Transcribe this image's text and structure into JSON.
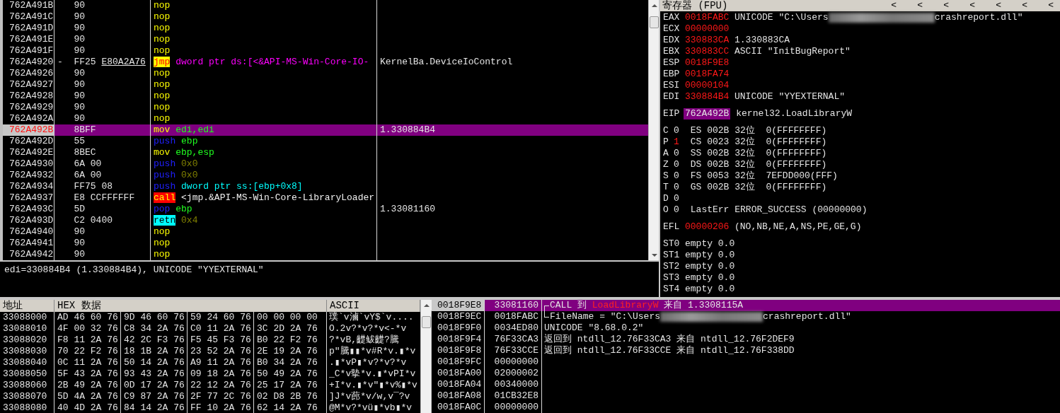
{
  "disassembly": {
    "rows": [
      {
        "address": "762A491B",
        "hex": "90",
        "tokens": [
          {
            "kind": "op",
            "text": "nop"
          }
        ],
        "selected": false
      },
      {
        "address": "762A491C",
        "hex": "90",
        "tokens": [
          {
            "kind": "op",
            "text": "nop"
          }
        ],
        "selected": false
      },
      {
        "address": "762A491D",
        "hex": "90",
        "tokens": [
          {
            "kind": "op",
            "text": "nop"
          }
        ],
        "selected": false
      },
      {
        "address": "762A491E",
        "hex": "90",
        "tokens": [
          {
            "kind": "op",
            "text": "nop"
          }
        ],
        "selected": false
      },
      {
        "address": "762A491F",
        "hex": "90",
        "tokens": [
          {
            "kind": "op",
            "text": "nop"
          }
        ],
        "selected": false
      },
      {
        "address": "762A4920",
        "marker": "-",
        "hex": "FF25",
        "hex_ref": "E80A2A76",
        "tokens": [
          {
            "kind": "jump",
            "text": "jmp"
          },
          {
            "kind": "import",
            "text": "dword ptr ds:[<&API-MS-Win-Core-IO-"
          }
        ],
        "comment": "KernelBa.DeviceIoControl",
        "selected": false
      },
      {
        "address": "762A4926",
        "hex": "90",
        "tokens": [
          {
            "kind": "op",
            "text": "nop"
          }
        ],
        "selected": false
      },
      {
        "address": "762A4927",
        "hex": "90",
        "tokens": [
          {
            "kind": "op",
            "text": "nop"
          }
        ],
        "selected": false
      },
      {
        "address": "762A4928",
        "hex": "90",
        "tokens": [
          {
            "kind": "op",
            "text": "nop"
          }
        ],
        "selected": false
      },
      {
        "address": "762A4929",
        "hex": "90",
        "tokens": [
          {
            "kind": "op",
            "text": "nop"
          }
        ],
        "selected": false
      },
      {
        "address": "762A492A",
        "hex": "90",
        "tokens": [
          {
            "kind": "op",
            "text": "nop"
          }
        ],
        "selected": false
      },
      {
        "address": "762A492B",
        "hex": "8BFF",
        "tokens": [
          {
            "kind": "op",
            "text": "mov"
          },
          {
            "kind": "reg",
            "text": "edi,edi"
          }
        ],
        "comment": "1.330884B4",
        "selected": true
      },
      {
        "address": "762A492D",
        "hex": "55",
        "tokens": [
          {
            "kind": "stack",
            "text": "push"
          },
          {
            "kind": "reg",
            "text": "ebp"
          }
        ],
        "selected": false
      },
      {
        "address": "762A492E",
        "hex": "8BEC",
        "tokens": [
          {
            "kind": "op",
            "text": "mov"
          },
          {
            "kind": "reg",
            "text": "ebp,esp"
          }
        ],
        "selected": false
      },
      {
        "address": "762A4930",
        "hex": "6A 00",
        "tokens": [
          {
            "kind": "stack",
            "text": "push"
          },
          {
            "kind": "imm",
            "text": "0x0"
          }
        ],
        "selected": false
      },
      {
        "address": "762A4932",
        "hex": "6A 00",
        "tokens": [
          {
            "kind": "stack",
            "text": "push"
          },
          {
            "kind": "imm",
            "text": "0x0"
          }
        ],
        "selected": false
      },
      {
        "address": "762A4934",
        "hex": "FF75 08",
        "tokens": [
          {
            "kind": "stack",
            "text": "push"
          },
          {
            "kind": "mem",
            "text": "dword ptr ss:[ebp+0x8]"
          }
        ],
        "selected": false
      },
      {
        "address": "762A4937",
        "hex": "E8 CCFFFFFF",
        "tokens": [
          {
            "kind": "call",
            "text": "call"
          },
          {
            "kind": "plain",
            "text": "<jmp.&API-MS-Win-Core-LibraryLoader"
          }
        ],
        "selected": false
      },
      {
        "address": "762A493C",
        "hex": "5D",
        "tokens": [
          {
            "kind": "stack",
            "text": "pop"
          },
          {
            "kind": "reg",
            "text": "ebp"
          }
        ],
        "comment": "1.33081160",
        "selected": false
      },
      {
        "address": "762A493D",
        "hex": "C2 0400",
        "tokens": [
          {
            "kind": "ret",
            "text": "retn"
          },
          {
            "kind": "imm",
            "text": "0x4"
          }
        ],
        "selected": false
      },
      {
        "address": "762A4940",
        "hex": "90",
        "tokens": [
          {
            "kind": "op",
            "text": "nop"
          }
        ],
        "selected": false
      },
      {
        "address": "762A4941",
        "hex": "90",
        "tokens": [
          {
            "kind": "op",
            "text": "nop"
          }
        ],
        "selected": false
      },
      {
        "address": "762A4942",
        "hex": "90",
        "tokens": [
          {
            "kind": "op",
            "text": "nop"
          }
        ],
        "selected": false
      }
    ]
  },
  "info_line": "edi=330884B4 (1.330884B4), UNICODE \"YYEXTERNAL\"",
  "registers": {
    "title": "寄存器 (FPU)",
    "arrows": [
      "<",
      "<",
      "<",
      "<",
      "<",
      "<",
      "<"
    ],
    "general": [
      {
        "name": "EAX",
        "value": "0018FABC",
        "changed": true,
        "comment": [
          {
            "kind": "text",
            "text": "UNICODE \"C:\\Users"
          },
          {
            "kind": "redacted"
          },
          {
            "kind": "text",
            "text": "crashreport.dll\""
          }
        ]
      },
      {
        "name": "ECX",
        "value": "00000000",
        "changed": true
      },
      {
        "name": "EDX",
        "value": "330883CA",
        "changed": true,
        "comment": [
          {
            "kind": "text",
            "text": "1.330883CA"
          }
        ]
      },
      {
        "name": "EBX",
        "value": "330883CC",
        "changed": true,
        "comment": [
          {
            "kind": "text",
            "text": "ASCII \"InitBugReport\""
          }
        ]
      },
      {
        "name": "ESP",
        "value": "0018F9E8",
        "changed": true
      },
      {
        "name": "EBP",
        "value": "0018FA74",
        "changed": true
      },
      {
        "name": "ESI",
        "value": "00000104",
        "changed": true
      },
      {
        "name": "EDI",
        "value": "330884B4",
        "changed": true,
        "comment": [
          {
            "kind": "text",
            "text": "UNICODE \"YYEXTERNAL\""
          }
        ]
      }
    ],
    "eip": {
      "name": "EIP",
      "value": "762A492B",
      "highlighted": true,
      "comment": "kernel32.LoadLibraryW"
    },
    "flags": [
      {
        "name": "C",
        "value": "0",
        "changed": false,
        "segment": "ES 002B 32位  0(FFFFFFFF)"
      },
      {
        "name": "P",
        "value": "1",
        "changed": true,
        "segment": "CS 0023 32位  0(FFFFFFFF)"
      },
      {
        "name": "A",
        "value": "0",
        "changed": false,
        "segment": "SS 002B 32位  0(FFFFFFFF)"
      },
      {
        "name": "Z",
        "value": "0",
        "changed": false,
        "segment": "DS 002B 32位  0(FFFFFFFF)"
      },
      {
        "name": "S",
        "value": "0",
        "changed": false,
        "segment": "FS 0053 32位  7EFDD000(FFF)"
      },
      {
        "name": "T",
        "value": "0",
        "changed": false,
        "segment": "GS 002B 32位  0(FFFFFFFF)"
      },
      {
        "name": "D",
        "value": "0",
        "changed": false
      },
      {
        "name": "O",
        "value": "0",
        "changed": false,
        "segment": "LastErr ERROR_SUCCESS (00000000)"
      }
    ],
    "efl": {
      "name": "EFL",
      "value": "00000206",
      "changed": true,
      "comment": "(NO,NB,NE,A,NS,PE,GE,G)"
    },
    "fpu": [
      {
        "name": "ST0",
        "text": "empty 0.0"
      },
      {
        "name": "ST1",
        "text": "empty 0.0"
      },
      {
        "name": "ST2",
        "text": "empty 0.0"
      },
      {
        "name": "ST3",
        "text": "empty 0.0"
      },
      {
        "name": "ST4",
        "text": "empty 0.0"
      }
    ]
  },
  "dump": {
    "columns": [
      "地址",
      "HEX 数据",
      "ASCII"
    ],
    "rows": [
      {
        "address": "33088000",
        "groups": [
          "AD 46 60 76",
          "9D 46 60 76",
          "59 24 60 76",
          "00 00 00 00"
        ],
        "ascii": "璞`v滷`vY$`v...."
      },
      {
        "address": "33088010",
        "groups": [
          "4F 00 32 76",
          "C8 34 2A 76",
          "C0 11 2A 76",
          "3C 2D 2A 76"
        ],
        "ascii": "O.2v?*v?*v<-*v"
      },
      {
        "address": "33088020",
        "groups": [
          "F8 11 2A 76",
          "42 2C F3 76",
          "F5 45 F3 76",
          "B0 22 F2 76"
        ],
        "ascii": "?*vB,齼鲅齼?騰"
      },
      {
        "address": "33088030",
        "groups": [
          "70 22 F2 76",
          "18 1B 2A 76",
          "23 52 2A 76",
          "2E 19 2A 76"
        ],
        "ascii": "p\"騰▮▮*v#R*v.▮*v"
      },
      {
        "address": "33088040",
        "groups": [
          "0C 11 2A 76",
          "50 14 2A 76",
          "A9 11 2A 76",
          "B0 34 2A 76"
        ],
        "ascii": ".▮*vP▮*v?*v?*v"
      },
      {
        "address": "33088050",
        "groups": [
          "5F 43 2A 76",
          "93 43 2A 76",
          "09 18 2A 76",
          "50 49 2A 76"
        ],
        "ascii": "_C*v摰*v.▮*vPI*v"
      },
      {
        "address": "33088060",
        "groups": [
          "2B 49 2A 76",
          "0D 17 2A 76",
          "22 12 2A 76",
          "25 17 2A 76"
        ],
        "ascii": "+I*v.▮*v\"▮*v%▮*v"
      },
      {
        "address": "33088070",
        "groups": [
          "5D 4A 2A 76",
          "C9 87 2A 76",
          "2F 77 2C 76",
          "02 D8 2B 76"
        ],
        "ascii": "]J*v蓢*v/w,v¯?v"
      },
      {
        "address": "33088080",
        "groups": [
          "40 4D 2A 76",
          "84 14 2A 76",
          "FF 10 2A 76",
          "62 14 2A 76"
        ],
        "ascii": "@M*v?*vü▮*vb▮*v"
      }
    ]
  },
  "stack": {
    "rows": [
      {
        "address": "0018F9E8",
        "value": "33081160",
        "selected": true,
        "bracket_top": true,
        "parts": [
          {
            "kind": "text",
            "text": "CALL 到 "
          },
          {
            "kind": "api",
            "text": "LoadLibraryW"
          },
          {
            "kind": "text",
            "text": " 来自 1.3308115A"
          }
        ]
      },
      {
        "address": "0018F9EC",
        "value": "0018FABC",
        "selected": false,
        "bracket_bottom": true,
        "parts": [
          {
            "kind": "text",
            "text": "FileName = \"C:\\Users"
          },
          {
            "kind": "redacted"
          },
          {
            "kind": "text",
            "text": "crashreport.dll\""
          }
        ]
      },
      {
        "address": "0018F9F0",
        "value": "0034ED80",
        "selected": false,
        "parts": [
          {
            "kind": "text",
            "text": "UNICODE \"8.68.0.2\""
          }
        ]
      },
      {
        "address": "0018F9F4",
        "value": "76F33CA3",
        "selected": false,
        "parts": [
          {
            "kind": "text",
            "text": "返回到 ntdll_12.76F33CA3 来自 ntdll_12.76F2DEF9"
          }
        ]
      },
      {
        "address": "0018F9F8",
        "value": "76F33CCE",
        "selected": false,
        "parts": [
          {
            "kind": "text",
            "text": "返回到 ntdll_12.76F33CCE 来自 ntdll_12.76F338DD"
          }
        ]
      },
      {
        "address": "0018F9FC",
        "value": "00000000",
        "selected": false
      },
      {
        "address": "0018FA00",
        "value": "02000002",
        "selected": false
      },
      {
        "address": "0018FA04",
        "value": "00340000",
        "selected": false
      },
      {
        "address": "0018FA08",
        "value": "01CB32E8",
        "selected": false
      },
      {
        "address": "0018FA0C",
        "value": "00000000",
        "selected": false
      }
    ]
  }
}
